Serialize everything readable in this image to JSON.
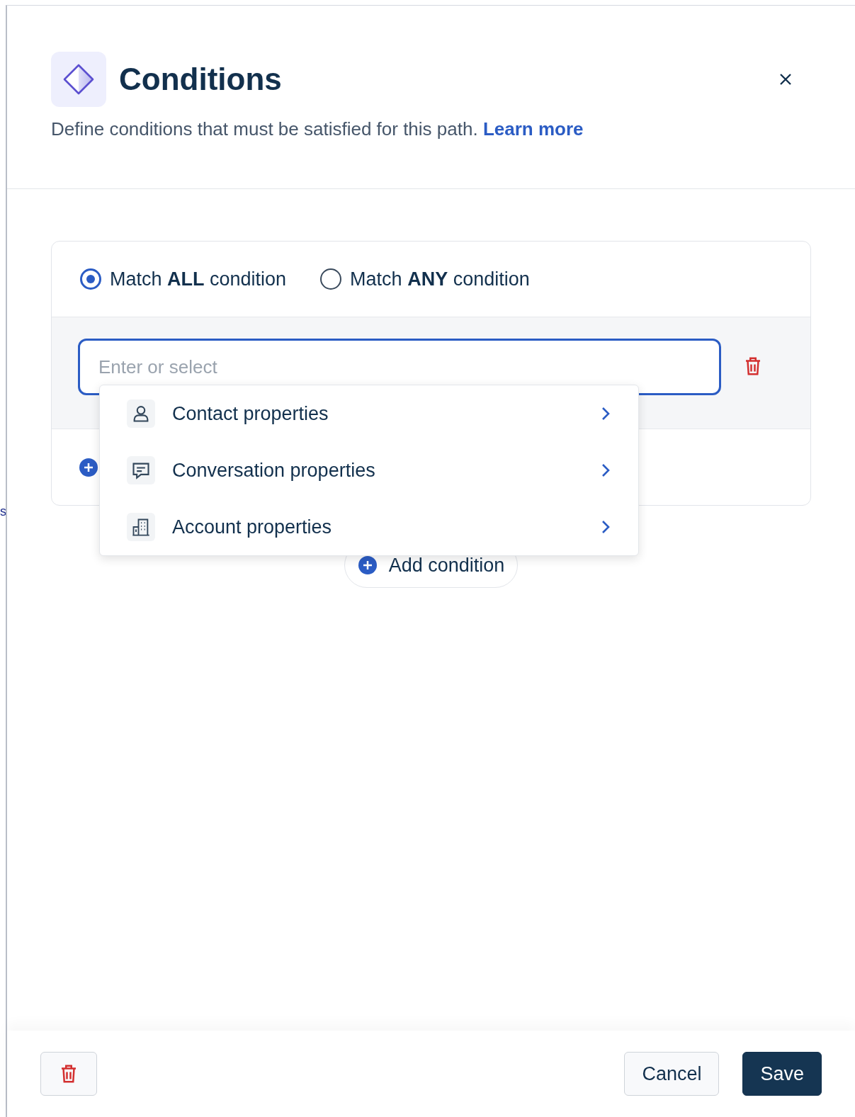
{
  "dialog": {
    "title": "Conditions",
    "subtitle": "Define conditions that must be satisfied for this path.",
    "learn_more": "Learn more"
  },
  "match_options": [
    {
      "label": "Match **ALL** condition",
      "selected": true
    },
    {
      "label": "Match **ANY** condition",
      "selected": false
    }
  ],
  "condition": {
    "placeholder": "Enter or select"
  },
  "dropdown": [
    {
      "kind": "contact",
      "label": "Contact properties"
    },
    {
      "kind": "conversation",
      "label": "Conversation properties"
    },
    {
      "kind": "account",
      "label": "Account properties"
    }
  ],
  "add_condition": "Add condition",
  "background_fragment": "s",
  "footer": {
    "cancel": "Cancel",
    "save": "Save"
  }
}
